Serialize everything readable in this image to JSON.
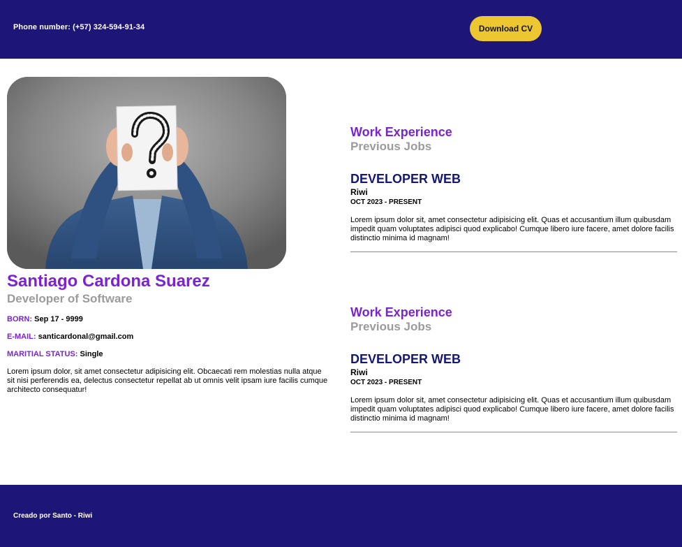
{
  "header": {
    "phone": "Phone number: (+57) 324-594-91-34",
    "download_label": "Download CV"
  },
  "profile": {
    "photo_icon": "question-mark-person-photo",
    "name": "Santiago Cardona Suarez",
    "role": "Developer of Software",
    "born_label": "BORN:",
    "born_value": "Sep 17 - 9999",
    "email_label": "E-MAIL:",
    "email_value": "santicardonal@gmail.com",
    "status_label": "MARITIAL STATUS:",
    "status_value": "Single",
    "bio": "Lorem ipsum dolor, sit amet consectetur adipisicing elit. Obcaecati rem molestias nulla atque sit nisi perferendis ea, delectus consectetur repellat ab ut omnis velit ipsam iure facilis cumque architecto consequatur!"
  },
  "work_sections": [
    {
      "title": "Work Experience",
      "subtitle": "Previous Jobs",
      "job_title": "DEVELOPER WEB",
      "company": "Riwi",
      "dates": "OCT 2023 - PRESENT",
      "description": "Lorem ipsum dolor sit, amet consectetur adipisicing elit. Quas et accusantium illum quibusdam impedit quam voluptates adipisci quod explicabo! Cumque libero iure facere, amet dolore facilis distinctio minima id magnam!"
    },
    {
      "title": "Work Experience",
      "subtitle": "Previous Jobs",
      "job_title": "DEVELOPER WEB",
      "company": "Riwi",
      "dates": "OCT 2023 - PRESENT",
      "description": "Lorem ipsum dolor sit, amet consectetur adipisicing elit. Quas et accusantium illum quibusdam impedit quam voluptates adipisci quod explicabo! Cumque libero iure facere, amet dolore facilis distinctio minima id magnam!"
    }
  ],
  "footer": {
    "credit": "Creado por Santo - Riwi"
  },
  "colors": {
    "header_bg": "#1e1677",
    "accent_purple": "#7b22d4",
    "button_yellow": "#ecc731",
    "job_title_navy": "#151777",
    "muted_gray": "#9b9b9b"
  }
}
